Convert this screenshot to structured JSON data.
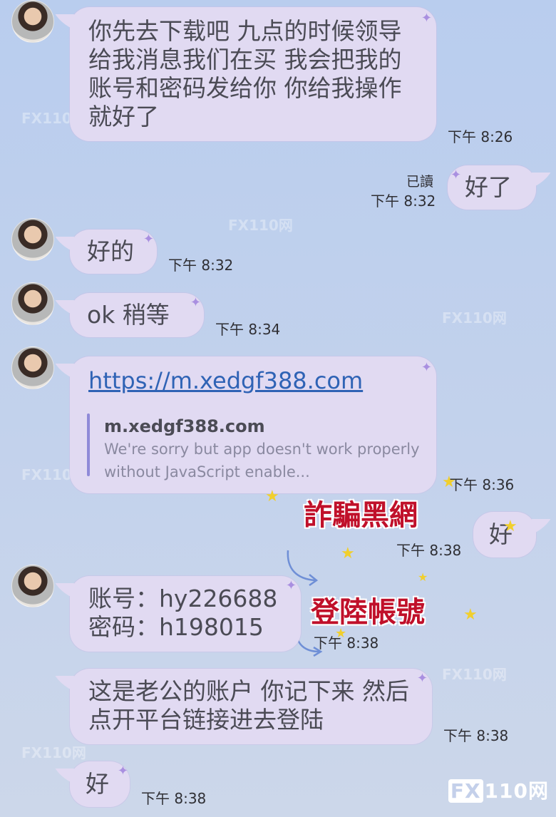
{
  "messages": {
    "m1": {
      "text": "你先去下载吧 九点的时候领导给我消息我们在买 我会把我的账号和密码发给你 你给我操作就好了",
      "time": "下午 8:26"
    },
    "m2": {
      "text": "好了",
      "status": "已讀",
      "time": "下午 8:32"
    },
    "m3": {
      "text": "好的",
      "time": "下午 8:32"
    },
    "m4": {
      "text": "ok 稍等",
      "time": "下午 8:34"
    },
    "m5": {
      "link": "https://m.xedgf388.com",
      "preview_domain": "m.xedgf388.com",
      "preview_desc": "We're sorry but app doesn't work properly without JavaScript enable...",
      "time": "下午 8:36"
    },
    "m6": {
      "text": "好",
      "time": "下午 8:38"
    },
    "m7": {
      "line1": "账号：hy226688",
      "line2": "密码：h198015",
      "time": "下午 8:38"
    },
    "m8": {
      "text": "这是老公的账户 你记下来 然后点开平台链接进去登陆",
      "time": "下午 8:38"
    },
    "m9": {
      "text": "好",
      "time": "下午 8:38"
    }
  },
  "overlays": {
    "label1": "詐騙黑網",
    "label2": "登陸帳號"
  },
  "watermark": {
    "text": "FX110网",
    "brand": "110网",
    "brand_box": "FX"
  },
  "colors": {
    "bubble": "#e1daf2",
    "overlay_red": "#c0102a",
    "star": "#f1cf2d"
  }
}
